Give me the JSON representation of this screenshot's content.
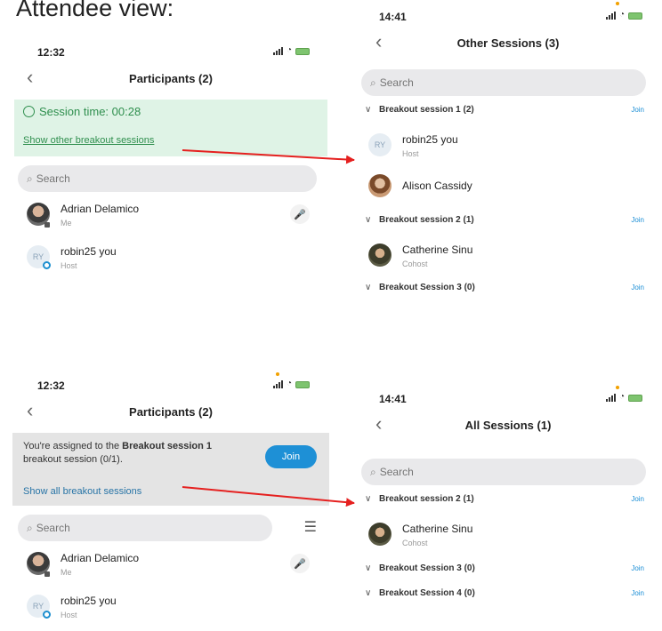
{
  "caption": "Attendee view:",
  "screen1": {
    "time": "12:32",
    "title": "Participants (2)",
    "session_time": "Session time: 00:28",
    "show_link": "Show other breakout sessions",
    "search_placeholder": "Search",
    "participants": [
      {
        "name": "Adrian Delamico",
        "sub": "Me"
      },
      {
        "name": "robin25 you",
        "sub": "Host",
        "initials": "RY"
      }
    ]
  },
  "screen2": {
    "time": "14:41",
    "title": "Other Sessions (3)",
    "search_placeholder": "Search",
    "sessions": [
      {
        "name": "Breakout session 1 (2)",
        "join": "Join"
      },
      {
        "name": "Breakout session 2 (1)",
        "join": "Join"
      },
      {
        "name": "Breakout Session 3 (0)",
        "join": "Join"
      }
    ],
    "members": [
      {
        "name": "robin25 you",
        "sub": "Host",
        "initials": "RY"
      },
      {
        "name": "Alison Cassidy",
        "sub": ""
      },
      {
        "name": "Catherine Sinu",
        "sub": "Cohost"
      }
    ]
  },
  "screen3": {
    "time": "12:32",
    "title": "Participants (2)",
    "assigned_prefix": "You're assigned to the ",
    "assigned_session": "Breakout session 1",
    "assigned_suffix": " breakout session (0/1).",
    "join_label": "Join",
    "show_link": "Show all breakout sessions",
    "search_placeholder": "Search",
    "participants": [
      {
        "name": "Adrian Delamico",
        "sub": "Me"
      },
      {
        "name": "robin25 you",
        "sub": "Host",
        "initials": "RY"
      }
    ]
  },
  "screen4": {
    "time": "14:41",
    "title": "All Sessions (1)",
    "search_placeholder": "Search",
    "sessions": [
      {
        "name": "Breakout session 2 (1)",
        "join": "Join"
      },
      {
        "name": "Breakout Session 3 (0)",
        "join": "Join"
      },
      {
        "name": "Breakout Session 4 (0)",
        "join": "Join"
      }
    ],
    "members": [
      {
        "name": "Catherine Sinu",
        "sub": "Cohost"
      }
    ]
  },
  "colors": {
    "arrow": "#e5201f",
    "join_button": "#1e90d6",
    "green_banner": "#dff3e6",
    "green_text": "#2f8f4e"
  },
  "icons": {
    "back": "chevron-left-icon",
    "search": "magnifier-icon",
    "chevron": "chevron-down-icon",
    "mic": "mic-icon",
    "list": "list-icon",
    "clock": "clock-icon"
  }
}
